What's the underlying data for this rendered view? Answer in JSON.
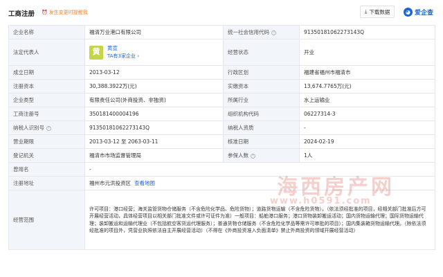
{
  "header": {
    "title": "工商注册",
    "alert": "发生变更时提醒我",
    "download_label": "下载数据",
    "brand": "爱企查"
  },
  "rows": [
    {
      "k1": "企业名称",
      "v1": "福清万业港口有限公司",
      "k2": "统一社会信用代码",
      "v2": "91350181062273143Q"
    },
    {
      "k1": "法定代表人",
      "rep_char": "黄",
      "rep_name": "黄宣",
      "rep_sub": "TA有3家企业 ›",
      "k2": "经营状态",
      "v2": "开业"
    },
    {
      "k1": "成立日期",
      "v1": "2013-03-12",
      "k2": "行政区划",
      "v2": "福建省福州市福清市"
    },
    {
      "k1": "注册资本",
      "v1": "30,388.3922万(元)",
      "k2": "实缴资本",
      "v2": "13,674.7765万(元)"
    },
    {
      "k1": "企业类型",
      "v1": "有限责任公司(外商投资、非独资)",
      "k2": "所属行业",
      "v2": "水上运输业"
    },
    {
      "k1": "工商注册号",
      "v1": "350181400004196",
      "k2": "组织机构代码",
      "v2": "06227314-3"
    },
    {
      "k1": "纳税人识别号",
      "v1": "91350181062273143Q",
      "k2": "纳税人资质",
      "v2": "-"
    },
    {
      "k1": "营业期限",
      "v1": "2013-03-12 至 2063-03-11",
      "k2": "核准日期",
      "v2": "2024-02-19"
    },
    {
      "k1": "登记机关",
      "v1": "福清市市场监督管理局",
      "k2": "参保人数",
      "v2": "1人"
    },
    {
      "k1": "曾用名",
      "v1": "-"
    },
    {
      "k1": "注册地址",
      "v1": "福州市元洪投资区",
      "link": "查看地图"
    },
    {
      "k1": "经营范围",
      "v1": "许可项目：港口经营；海关监管货物仓储服务（不含危险化学品、危险货物）；道路货物运输（不含危险货物）。（依法须经批准的项目，经相关部门批准后方可开展经营活动，具体经营项目以相关部门批准文件或许可证件为准）一般项目：船舶港口服务；港口货物装卸搬运活动；国内货物运输代理；国际货物运输代理；装卸搬运和运输代理业（不包括航空客货运代理服务）；普通货物仓储服务（不含危险化学品等需许可审批的项目）；国内集装箱货物运输代理。（除依法须经批准的项目外，凭营业执照依法自主开展经营活动）（不得在《外商投资准入负面清单》禁止外商投资的领域开展经营活动）"
    }
  ],
  "watermark": {
    "main": "海西房产网",
    "url": "www.h0591.com"
  },
  "colors": {
    "accent": "#1a66d8",
    "label_bg": "#f2f5fa",
    "border": "#e4e7ed",
    "alert": "#f5832b",
    "avatar": "#c6d44a"
  }
}
